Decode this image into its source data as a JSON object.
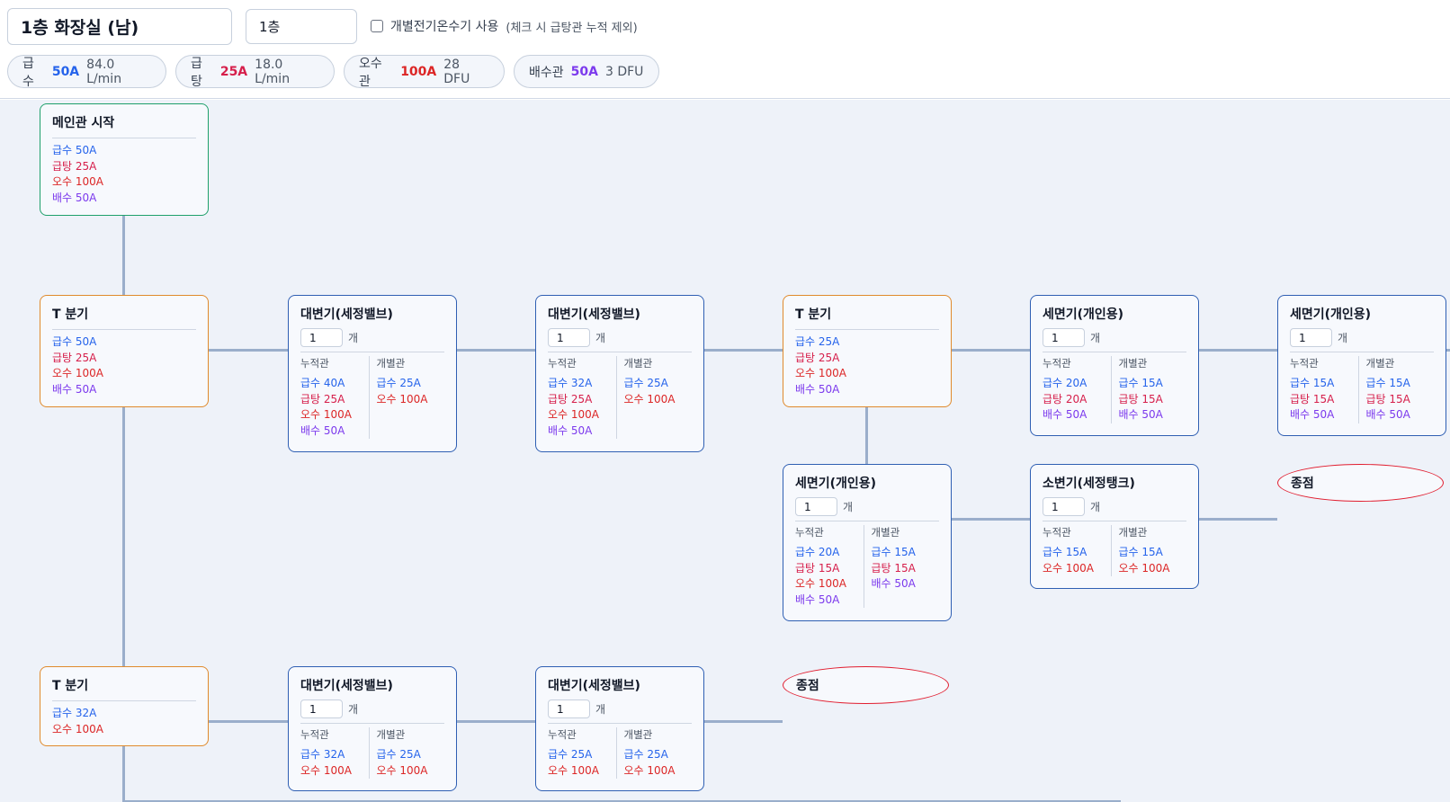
{
  "header": {
    "title": "1층 화장실 (남)",
    "floor": "1층",
    "checkbox_label": "개별전기온수기 사용",
    "checkbox_note": "(체크 시 급탕관 누적 제외)",
    "checkbox_checked": false
  },
  "summary": [
    {
      "label": "급수",
      "size": "50A",
      "sub": "84.0 L/min",
      "color": "#2563eb"
    },
    {
      "label": "급탕",
      "size": "25A",
      "sub": "18.0 L/min",
      "color": "#d61f4b"
    },
    {
      "label": "오수관",
      "size": "100A",
      "sub": "28 DFU",
      "color": "#dc2626"
    },
    {
      "label": "배수관",
      "size": "50A",
      "sub": "3 DFU",
      "color": "#7c3aed"
    }
  ],
  "labels": {
    "cumulative": "누적관",
    "individual": "개별관",
    "unit": "개"
  },
  "nodes": {
    "main": {
      "title": "메인관 시작",
      "specs": [
        "급수 50A",
        "급탕 25A",
        "오수 100A",
        "배수 50A"
      ]
    },
    "tee1": {
      "title": "T 분기",
      "specs": [
        "급수 50A",
        "급탕 25A",
        "오수 100A",
        "배수 50A"
      ]
    },
    "wc1": {
      "title": "대변기(세정밸브)",
      "qty": "1",
      "cum": [
        "급수 40A",
        "급탕 25A",
        "오수 100A",
        "배수 50A"
      ],
      "ind": [
        "급수 25A",
        "오수 100A"
      ]
    },
    "wc2": {
      "title": "대변기(세정밸브)",
      "qty": "1",
      "cum": [
        "급수 32A",
        "급탕 25A",
        "오수 100A",
        "배수 50A"
      ],
      "ind": [
        "급수 25A",
        "오수 100A"
      ]
    },
    "tee2": {
      "title": "T 분기",
      "specs": [
        "급수 25A",
        "급탕 25A",
        "오수 100A",
        "배수 50A"
      ]
    },
    "lav1": {
      "title": "세면기(개인용)",
      "qty": "1",
      "cum": [
        "급수 20A",
        "급탕 20A",
        "배수 50A"
      ],
      "ind": [
        "급수 15A",
        "급탕 15A",
        "배수 50A"
      ]
    },
    "lav2": {
      "title": "세면기(개인용)",
      "qty": "1",
      "cum": [
        "급수 15A",
        "급탕 15A",
        "배수 50A"
      ],
      "ind": [
        "급수 15A",
        "급탕 15A",
        "배수 50A"
      ]
    },
    "lav3": {
      "title": "세면기(개인용)",
      "qty": "1",
      "cum": [
        "급수 20A",
        "급탕 15A",
        "오수 100A",
        "배수 50A"
      ],
      "ind": [
        "급수 15A",
        "급탕 15A",
        "배수 50A"
      ]
    },
    "ur1": {
      "title": "소변기(세정탱크)",
      "qty": "1",
      "cum": [
        "급수 15A",
        "오수 100A"
      ],
      "ind": [
        "급수 15A",
        "오수 100A"
      ]
    },
    "end1": {
      "title": "종점"
    },
    "tee3": {
      "title": "T 분기",
      "specs": [
        "급수 32A",
        "오수 100A"
      ]
    },
    "wc3": {
      "title": "대변기(세정밸브)",
      "qty": "1",
      "cum": [
        "급수 32A",
        "오수 100A"
      ],
      "ind": [
        "급수 25A",
        "오수 100A"
      ]
    },
    "wc4": {
      "title": "대변기(세정밸브)",
      "qty": "1",
      "cum": [
        "급수 25A",
        "오수 100A"
      ],
      "ind": [
        "급수 25A",
        "오수 100A"
      ]
    },
    "end2": {
      "title": "종점"
    }
  }
}
